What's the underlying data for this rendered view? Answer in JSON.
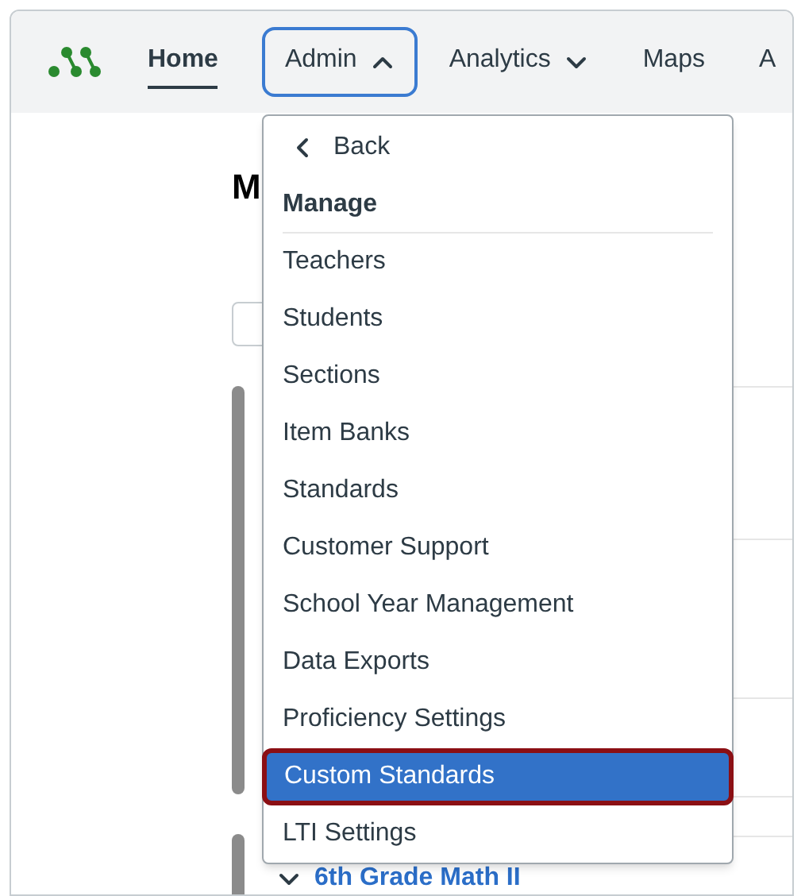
{
  "nav": {
    "items": [
      {
        "label": "Home",
        "kind": "link",
        "selected": true
      },
      {
        "label": "Admin",
        "kind": "dropdown",
        "selected": false,
        "expanded": true
      },
      {
        "label": "Analytics",
        "kind": "dropdown",
        "selected": false,
        "expanded": false
      },
      {
        "label": "Maps",
        "kind": "link",
        "selected": false
      },
      {
        "label": "A",
        "kind": "link",
        "selected": false
      }
    ]
  },
  "page": {
    "heading": "M",
    "course_link": "6th Grade Math II"
  },
  "menu": {
    "back": "Back",
    "section": "Manage",
    "items": [
      {
        "label": "Teachers",
        "selected": false
      },
      {
        "label": "Students",
        "selected": false
      },
      {
        "label": "Sections",
        "selected": false
      },
      {
        "label": "Item Banks",
        "selected": false
      },
      {
        "label": "Standards",
        "selected": false
      },
      {
        "label": "Customer Support",
        "selected": false
      },
      {
        "label": "School Year Management",
        "selected": false
      },
      {
        "label": "Data Exports",
        "selected": false
      },
      {
        "label": "Proficiency Settings",
        "selected": false
      },
      {
        "label": "Custom Standards",
        "selected": true
      },
      {
        "label": "LTI Settings",
        "selected": false
      }
    ]
  }
}
